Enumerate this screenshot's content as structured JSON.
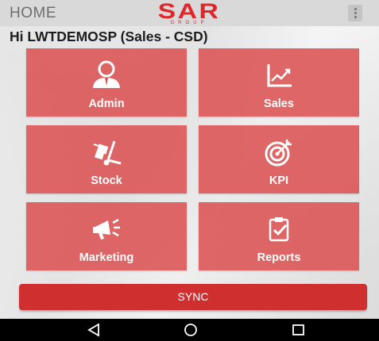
{
  "appbar": {
    "title": "HOME",
    "logo_main": "SAR",
    "logo_sub": "GROUP",
    "menu_icon": "overflow-menu-icon"
  },
  "greeting": "Hi LWTDEMOSP (Sales - CSD)",
  "tiles": [
    {
      "label": "Admin",
      "icon": "user-icon"
    },
    {
      "label": "Sales",
      "icon": "line-chart-icon"
    },
    {
      "label": "Stock",
      "icon": "hand-truck-icon"
    },
    {
      "label": "KPI",
      "icon": "target-icon"
    },
    {
      "label": "Marketing",
      "icon": "megaphone-icon"
    },
    {
      "label": "Reports",
      "icon": "clipboard-check-icon"
    }
  ],
  "sync_label": "SYNC",
  "navbar": {
    "back_icon": "back-triangle-icon",
    "home_icon": "home-circle-icon",
    "recents_icon": "recents-square-icon"
  },
  "colors": {
    "accent": "#e0262b",
    "tile": "#db4f4f",
    "sync": "#cf2f2f",
    "appbar": "#d9d9d9"
  }
}
